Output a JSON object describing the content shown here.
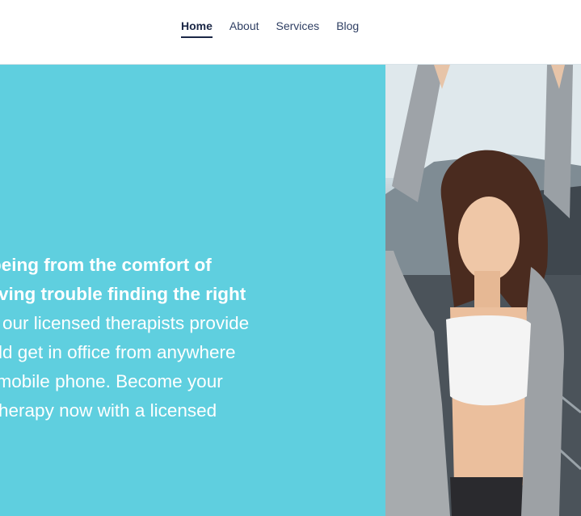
{
  "nav": {
    "items": [
      {
        "label": "Home",
        "active": true
      },
      {
        "label": "About",
        "active": false
      },
      {
        "label": "Services",
        "active": false
      },
      {
        "label": "Blog",
        "active": false
      }
    ]
  },
  "hero": {
    "lines": [
      "well-being from the comfort of",
      "ou having trouble finding the right",
      "eTalk, our licensed therapists provide",
      "u would get in office from anywhere",
      "op or mobile phone. Become your",
      "Start therapy now with a licensed"
    ],
    "background_color": "#5fcfdf",
    "image_icon": "woman-stretching-photo"
  }
}
